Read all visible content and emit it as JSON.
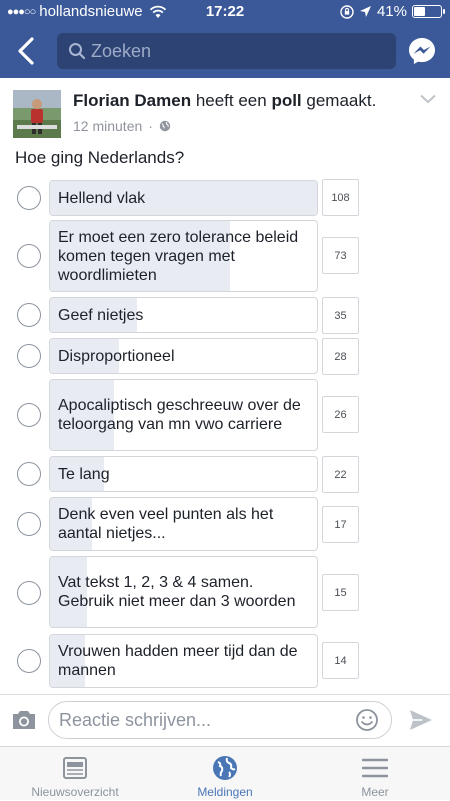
{
  "status_bar": {
    "carrier": "hollandsnieuwe",
    "time": "17:22",
    "battery": "41%",
    "battery_level": 0.41
  },
  "nav": {
    "search_placeholder": "Zoeken"
  },
  "post": {
    "author": "Florian Damen",
    "action_text": " heeft een ",
    "object": "poll",
    "action_suffix": " gemaakt.",
    "timestamp": "12 minuten",
    "separator": "·",
    "question": "Hoe ging Nederlands?",
    "options": [
      {
        "label": "Hellend vlak",
        "votes": "108",
        "share": 1.0
      },
      {
        "label": "Er moet een zero tolerance beleid komen tegen vragen met woordlimieten",
        "votes": "73",
        "share": 0.676
      },
      {
        "label": "Geef nietjes",
        "votes": "35",
        "share": 0.324
      },
      {
        "label": "Disproportioneel",
        "votes": "28",
        "share": 0.259
      },
      {
        "label": "Apocaliptisch geschreeuw over de teloorgang van mn vwo carriere",
        "votes": "26",
        "share": 0.241
      },
      {
        "label": "Te lang",
        "votes": "22",
        "share": 0.204
      },
      {
        "label": "Denk even veel punten als het aantal nietjes...",
        "votes": "17",
        "share": 0.157
      },
      {
        "label": "Vat tekst 1, 2, 3 & 4 samen. Gebruik niet meer dan 3 woorden",
        "votes": "15",
        "share": 0.139
      },
      {
        "label": "Vrouwen hadden meer tijd dan de mannen",
        "votes": "14",
        "share": 0.13
      }
    ]
  },
  "comment": {
    "placeholder": "Reactie schrijven..."
  },
  "tabs": [
    {
      "label": "Nieuwsoverzicht",
      "icon": "newsfeed-icon",
      "active": false
    },
    {
      "label": "Meldingen",
      "icon": "globe-icon",
      "active": true
    },
    {
      "label": "Meer",
      "icon": "menu-icon",
      "active": false
    }
  ],
  "colors": {
    "brand": "#3b5998",
    "active_tab": "#4a76b6"
  }
}
